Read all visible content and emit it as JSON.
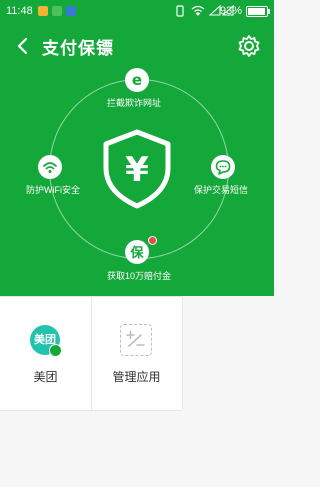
{
  "status_bar": {
    "time": "11:48",
    "battery_percent_text": "93%",
    "battery_level": 0.93
  },
  "header": {
    "title": "支付保镖"
  },
  "guard": {
    "top": {
      "glyph": "e",
      "label": "拦截欺诈网址"
    },
    "left": {
      "glyph": "wifi",
      "label": "防护WiFi安全"
    },
    "right": {
      "glyph": "sms",
      "label": "保护交易短信"
    },
    "bottom": {
      "glyph": "保",
      "label": "获取10万赔付金"
    },
    "center_symbol": "¥"
  },
  "apps": [
    {
      "label": "美团",
      "icon_text": "美团"
    },
    {
      "label": "管理应用",
      "icon_text": "+/−"
    }
  ],
  "colors": {
    "primary_green": "#14a73a",
    "meituan_teal": "#23c2ad",
    "alert_red": "#e84b4b"
  }
}
